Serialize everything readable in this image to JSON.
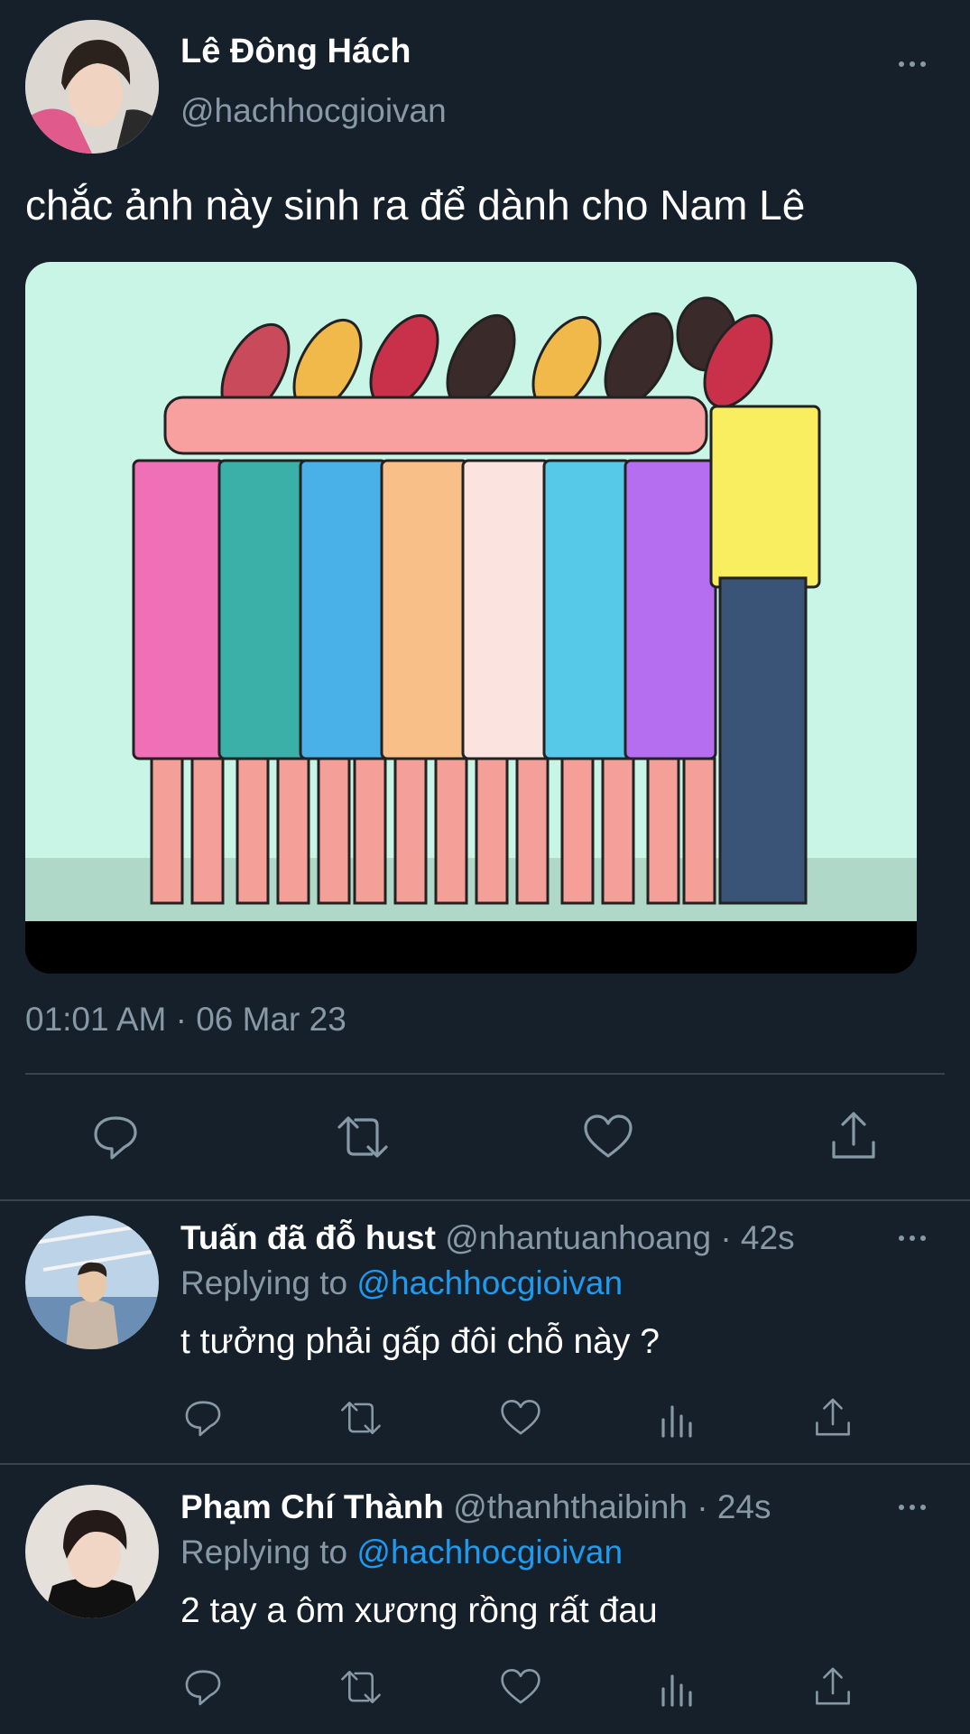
{
  "tweet": {
    "author_name": "Lê Đông Hách",
    "author_handle": "@hachhocgioivan",
    "text": "chắc ảnh này sinh ra để dành cho Nam Lê",
    "timestamp": "01:01 AM · 06 Mar 23",
    "image_icon": "cartoon-group-hug-image"
  },
  "actions": {
    "reply_icon": "reply-icon",
    "retweet_icon": "retweet-icon",
    "like_icon": "heart-icon",
    "share_icon": "share-icon",
    "analytics_icon": "analytics-icon"
  },
  "replies": [
    {
      "author_name": "Tuấn đã đỗ hust",
      "author_handle": "@nhantuanhoang",
      "time": "· 42s",
      "replying_label": "Replying to",
      "replying_to": "@hachhocgioivan",
      "text": "t tưởng phải gấp đôi chỗ này ?"
    },
    {
      "author_name": "Phạm Chí Thành",
      "author_handle": "@thanhthaibinh",
      "time": "· 24s",
      "replying_label": "Replying to",
      "replying_to": "@hachhocgioivan",
      "text": "2 tay a ôm xương rồng rất đau"
    }
  ],
  "colors": {
    "background": "#15202b",
    "muted": "#8899a6",
    "link": "#1d9bf0",
    "divider": "#38444d"
  }
}
